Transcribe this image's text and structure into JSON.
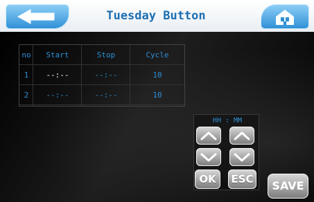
{
  "header": {
    "title": "Tuesday Button",
    "back_icon": "arrow-left-icon",
    "home_icon": "home-icon",
    "accent": "#1d6fb2"
  },
  "schedule_table": {
    "columns": [
      "no",
      "Start",
      "Stop",
      "Cycle"
    ],
    "rows": [
      {
        "no": "1",
        "start": "--:--",
        "stop": "--:--",
        "cycle": "10"
      },
      {
        "no": "2",
        "start": "--:--",
        "stop": "--:--",
        "cycle": "10"
      }
    ]
  },
  "time_editor": {
    "label": "HH : MM",
    "ok_label": "OK",
    "esc_label": "ESC",
    "up_icon": "chevron-up-icon",
    "down_icon": "chevron-down-icon"
  },
  "actions": {
    "save_label": "SAVE"
  }
}
